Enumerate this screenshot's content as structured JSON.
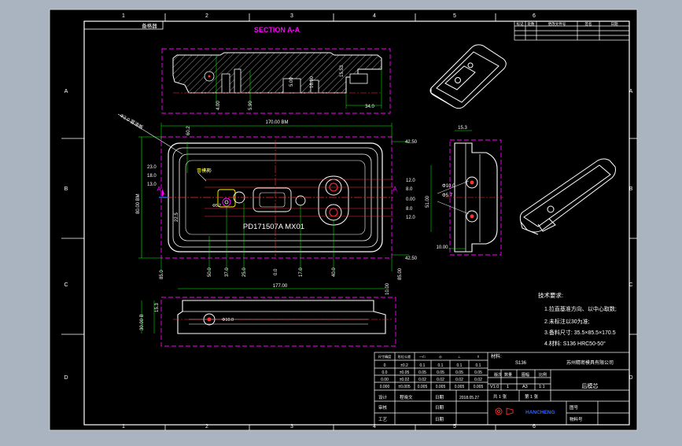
{
  "colors": {
    "background": "#000000",
    "frame": "#ffffff",
    "hidden": "#ff00ff",
    "dimension": "#00ff00",
    "center": "#ff3030",
    "text": "#ffffff",
    "yellow": "#ffff00",
    "cyan": "#00ffff",
    "blue": "#3060ff"
  },
  "border": {
    "columns": [
      "1",
      "2",
      "3",
      "4",
      "5",
      "6"
    ],
    "rows": [
      "A",
      "B",
      "C",
      "D"
    ],
    "corner_label": "备格器"
  },
  "section": {
    "title": "SECTION A-A",
    "dims": {
      "d1": "4.00",
      "d2": "5.90",
      "d3": "5.00",
      "d4": "16.00",
      "d5": "15.53",
      "d6": "34.0"
    }
  },
  "main_view": {
    "engraving": "PD171507A  MX01",
    "label_hole": "冒模孔",
    "label_gate": "Φ3.0 冒浇板",
    "section_mark": "A",
    "top_dims": {
      "overall": "170.00 BM",
      "small": "60.2",
      "angle": "4.15"
    },
    "left_dims": {
      "d1": "23.0",
      "d2": "18.0",
      "d3": "13.0",
      "d4": "22.5",
      "height": "80.00 BM",
      "hole": "Φ5.2"
    },
    "right_dims": {
      "top": "42.50",
      "d1": "12.0",
      "d2": "8.0",
      "d3": "0.00",
      "d4": "8.0",
      "d5": "12.0",
      "bottom": "42.50"
    },
    "bottom_dims": {
      "d1": "85.0",
      "d2": "50.0",
      "d3": "37.0",
      "d4": "25.0",
      "d5": "0.0",
      "d6": "17.0",
      "d7": "40.0",
      "d8": "85.00"
    }
  },
  "side_view": {
    "top": "15.3",
    "holes": [
      "Φ10.0",
      "Φ5.7"
    ],
    "left": "51.00",
    "bottom": "10.00"
  },
  "bottom_view": {
    "width": "177.00",
    "right": "10.00",
    "left": "15.3",
    "height": "30.00 B",
    "hole": "Φ10.0"
  },
  "tech_notes": {
    "title": "技术要求:",
    "lines": [
      "1.拉直基准方向、以中心取数;",
      "2.未标注以30为准;",
      "3.备料尺寸: 35.5×85.5×170.5",
      "4.材料: S136 HRC50-50°"
    ]
  },
  "title_block": {
    "tol_headers": [
      "尺寸精度",
      "形位公差",
      "—/□",
      "◎",
      "⊥",
      "//",
      "⌒"
    ],
    "tol_rows": [
      [
        "0",
        "±0.2",
        "0.1",
        "0.1",
        "0.1",
        "0.1"
      ],
      [
        "0.0",
        "±0.05",
        "0.05",
        "0.05",
        "0.05",
        "0.05"
      ],
      [
        "0.00",
        "±0.02",
        "0.02",
        "0.02",
        "0.02",
        "0.02"
      ],
      [
        "0.000",
        "±0.005",
        "0.005",
        "0.005",
        "0.005",
        "0.005"
      ]
    ],
    "material_label": "材料:",
    "material": "S136",
    "company": "苏州精密模具有限公司",
    "headers": [
      "版次",
      "数量",
      "图幅",
      "比例"
    ],
    "values": [
      "V1.0",
      "1",
      "A3",
      "1:1"
    ],
    "sheet_total": "共 1 张",
    "sheet_no": "第 1 张",
    "part_name": "后模芯",
    "design_label": "设计",
    "designer": "程晓文",
    "date_label": "日期",
    "date": "2018.05.27",
    "review_label": "审核",
    "process_label": "工艺",
    "logo": "HANCHENG",
    "drawing_no_label": "图号",
    "material_no_label": "物料号"
  },
  "revision_table": {
    "headers": [
      "标记",
      "处数",
      "更改文件号",
      "签名",
      "日期"
    ]
  }
}
